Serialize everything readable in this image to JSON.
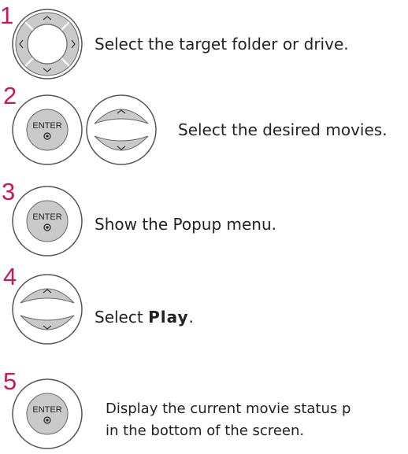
{
  "colors": {
    "step_number": "#c8175d",
    "button_outline": "#555555",
    "button_fill": "#cccccc"
  },
  "steps": [
    {
      "number": "1",
      "icon": "navigation-dpad-icon",
      "text": "Select the target folder or drive."
    },
    {
      "number": "2",
      "icon": "enter-button-and-up-down-buttons-icon",
      "enter_label": "ENTER",
      "text": "Select the desired movies."
    },
    {
      "number": "3",
      "icon": "enter-button-icon",
      "enter_label": "ENTER",
      "text": "Show the Popup menu."
    },
    {
      "number": "4",
      "icon": "up-down-buttons-icon",
      "text_prefix": "Select ",
      "text_bold": "Play",
      "text_suffix": "."
    },
    {
      "number": "5",
      "icon": "enter-button-icon",
      "enter_label": "ENTER",
      "text_line1": "Display the current movie status p",
      "text_line2": "in the bottom of the screen."
    }
  ]
}
